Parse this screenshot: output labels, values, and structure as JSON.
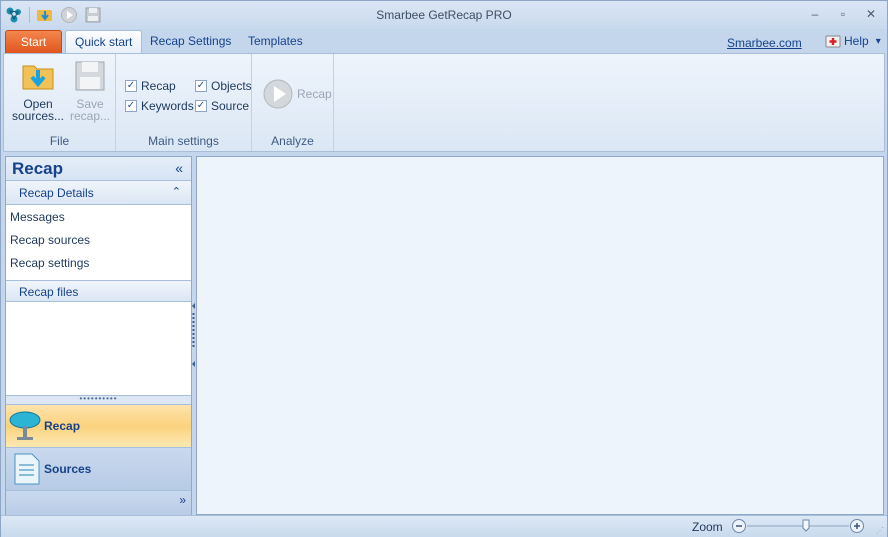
{
  "window": {
    "title": "Smarbee GetRecap PRO"
  },
  "quick_access": {
    "icons": [
      "app-logo-icon",
      "open-icon",
      "play-icon",
      "save-icon"
    ]
  },
  "window_controls": {
    "minimize": "–",
    "restore": "▫",
    "close": "✕"
  },
  "tabs": [
    {
      "label": "Start"
    },
    {
      "label": "Quick start"
    },
    {
      "label": "Recap Settings"
    },
    {
      "label": "Templates"
    }
  ],
  "header_link": "Smarbee.com",
  "help": {
    "label": "Help",
    "arrow": "▾"
  },
  "ribbon": {
    "file": {
      "label": "File",
      "open": "Open sources...",
      "save": "Save recap..."
    },
    "main_settings": {
      "label": "Main settings",
      "checks": [
        {
          "label": "Recap",
          "checked": true
        },
        {
          "label": "Keywords",
          "checked": true
        },
        {
          "label": "Objects",
          "checked": true
        },
        {
          "label": "Source",
          "checked": true
        }
      ]
    },
    "analyze": {
      "label": "Analyze",
      "recap": "Recap"
    }
  },
  "nav": {
    "title": "Recap",
    "collapse": "«",
    "details": {
      "title": "Recap Details",
      "toggle": "⌃",
      "items": [
        "Messages",
        "Recap sources",
        "Recap settings"
      ]
    },
    "files": {
      "title": "Recap files"
    },
    "grip": "••••••••••",
    "buttons": [
      {
        "label": "Recap",
        "selected": true
      },
      {
        "label": "Sources",
        "selected": false
      }
    ],
    "more": "»"
  },
  "status": {
    "zoom_label": "Zoom",
    "zoom_value": 0.5
  }
}
